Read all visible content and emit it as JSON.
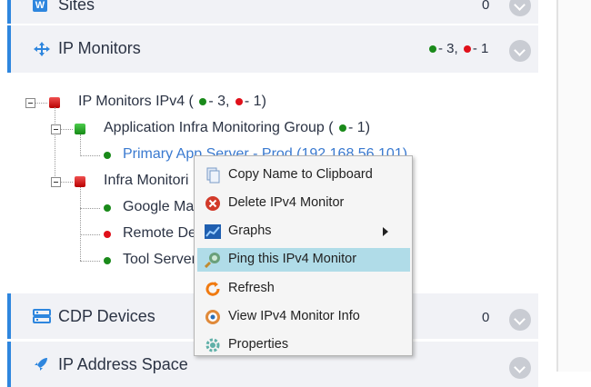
{
  "sections": {
    "sites": {
      "title": "Sites",
      "count": "0"
    },
    "ip_monitors": {
      "title": "IP Monitors",
      "green_count": "- 3,",
      "red_count": "- 1"
    },
    "cdp_devices": {
      "title": "CDP Devices",
      "count": "0"
    },
    "ip_address_space": {
      "title": "IP Address Space"
    }
  },
  "tree": {
    "root": {
      "label": "IP Monitors IPv4 (",
      "green": "- 3,",
      "red": "- 1)"
    },
    "group1": {
      "label": "Application Infra Monitoring Group (",
      "green": "- 1)"
    },
    "group1_item": {
      "label": "Primary App Server - Prod (192.168.56.101)"
    },
    "group2": {
      "label": "Infra Monitori"
    },
    "group2_items": [
      "Google Ma",
      "Remote De",
      "Tool Server"
    ]
  },
  "context_menu": {
    "items": [
      {
        "label": "Copy Name to Clipboard",
        "icon": "clipboard-icon"
      },
      {
        "label": "Delete IPv4 Monitor",
        "icon": "delete-icon"
      },
      {
        "label": "Graphs",
        "icon": "chart-icon"
      },
      {
        "label": "Ping this IPv4 Monitor",
        "icon": "ping-icon"
      },
      {
        "label": "Refresh",
        "icon": "refresh-icon"
      },
      {
        "label": "View IPv4 Monitor Info",
        "icon": "eye-icon"
      },
      {
        "label": "Properties",
        "icon": "gear-icon"
      }
    ]
  },
  "colors": {
    "accent": "#2e86de",
    "status_green": "#1a8a1a",
    "status_red": "#e0101a",
    "menu_highlight": "#b0dce8",
    "link": "#3a7ad0"
  }
}
